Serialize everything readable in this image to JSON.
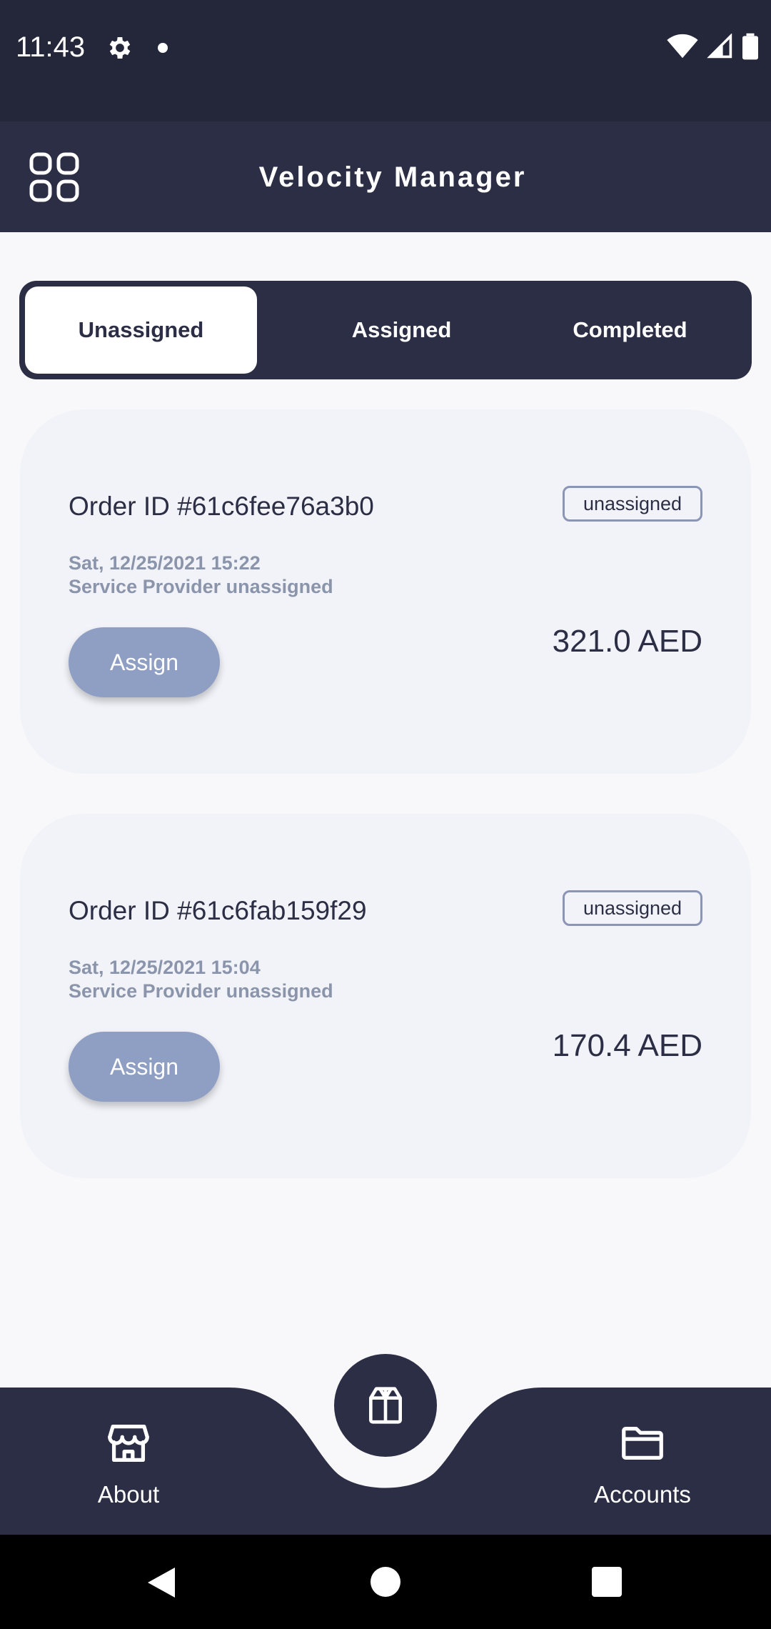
{
  "status_bar": {
    "time": "11:43"
  },
  "app_bar": {
    "title": "Velocity Manager"
  },
  "tabs": [
    {
      "label": "Unassigned",
      "active": true
    },
    {
      "label": "Assigned",
      "active": false
    },
    {
      "label": "Completed",
      "active": false
    }
  ],
  "orders": [
    {
      "id": "Order ID #61c6fee76a3b0",
      "status": "unassigned",
      "date": "Sat, 12/25/2021 15:22",
      "provider": "Service Provider unassigned",
      "amount": "321.0 AED",
      "button": "Assign"
    },
    {
      "id": "Order ID #61c6fab159f29",
      "status": "unassigned",
      "date": "Sat, 12/25/2021 15:04",
      "provider": "Service Provider unassigned",
      "amount": "170.4 AED",
      "button": "Assign"
    }
  ],
  "bottom_nav": {
    "left": {
      "label": "About",
      "icon": "store-icon"
    },
    "center": {
      "icon": "package-icon"
    },
    "right": {
      "label": "Accounts",
      "icon": "folder-icon"
    }
  },
  "colors": {
    "primary": "#2c2e45",
    "status_bar": "#242639",
    "assign_button": "#8f9ec3",
    "card": "#f2f3f8",
    "background": "#f8f8fa"
  }
}
